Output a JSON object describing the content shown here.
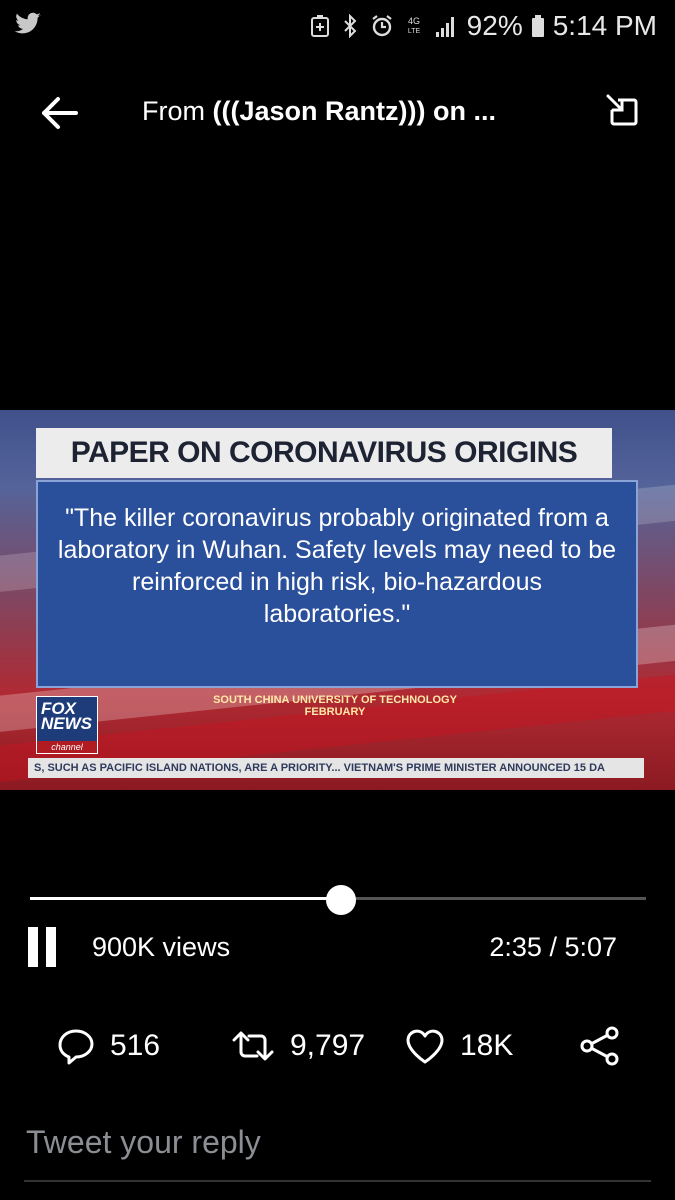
{
  "status_bar": {
    "app_icon": "twitter-bird-icon",
    "battery": "92%",
    "time": "5:14 PM",
    "network": "4G LTE",
    "icons": [
      "battery-saver-icon",
      "bluetooth-icon",
      "alarm-icon",
      "lte-icon",
      "signal-icon",
      "battery-icon"
    ]
  },
  "header": {
    "title_prefix": "From ",
    "title_bold": "(((Jason Rantz))) on ...",
    "back_icon": "back-arrow-icon",
    "pip_icon": "minimize-pip-icon"
  },
  "video": {
    "headline": "PAPER ON CORONAVIRUS ORIGINS",
    "quote": "\"The killer coronavirus probably originated from a laboratory in Wuhan. Safety levels may need to be reinforced in high risk, bio-hazardous laboratories.\"",
    "source_line1": "SOUTH CHINA UNIVERSITY OF TECHNOLOGY",
    "source_line2": "FEBRUARY",
    "logo_line1": "FOX",
    "logo_line2": "NEWS",
    "logo_line3": "channel",
    "ticker": "S, SUCH AS PACIFIC ISLAND NATIONS, ARE A PRIORITY...    VIETNAM'S PRIME MINISTER ANNOUNCED 15 DA"
  },
  "player": {
    "progress_fraction": 0.505,
    "views": "900K views",
    "time": "2:35 / 5:07"
  },
  "actions": {
    "replies": "516",
    "retweets": "9,797",
    "likes": "18K"
  },
  "reply": {
    "placeholder": "Tweet your reply"
  },
  "colors": {
    "background": "#000000",
    "headline_bg": "#ececec",
    "quote_bg": "#2a4f9b",
    "reply_placeholder": "#8b8f94"
  }
}
